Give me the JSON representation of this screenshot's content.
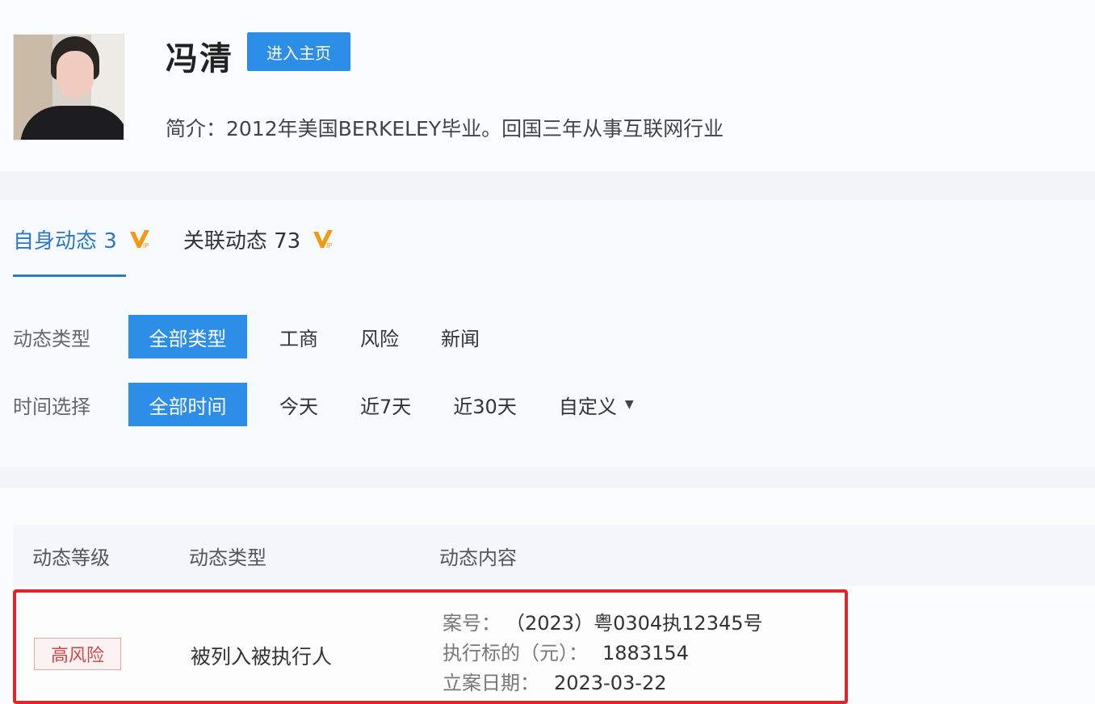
{
  "profile": {
    "name": "冯清",
    "home_button": "进入主页",
    "intro": "简介：2012年美国BERKELEY毕业。回国三年从事互联网行业"
  },
  "tabs": [
    {
      "label": "自身动态 3",
      "active": true
    },
    {
      "label": "关联动态 73",
      "active": false
    }
  ],
  "filters": {
    "type": {
      "label": "动态类型",
      "options": [
        "全部类型",
        "工商",
        "风险",
        "新闻"
      ],
      "selected": "全部类型"
    },
    "time": {
      "label": "时间选择",
      "options": [
        "全部时间",
        "今天",
        "近7天",
        "近30天",
        "自定义"
      ],
      "selected": "全部时间"
    }
  },
  "table": {
    "headers": [
      "动态等级",
      "动态类型",
      "动态内容"
    ],
    "rows": [
      {
        "level": "高风险",
        "type": "被列入被执行人",
        "details": [
          {
            "key": "案号：",
            "value": "（2023）粤0304执12345号"
          },
          {
            "key": "执行标的（元）：",
            "value": "1883154"
          },
          {
            "key": "立案日期：",
            "value": "2023-03-22"
          }
        ]
      }
    ]
  },
  "colors": {
    "accent": "#2d8ee8",
    "active_tab": "#2a78c6",
    "highlight_border": "#e0262b",
    "risk": "#d04848",
    "vip_badge": "#f29a16"
  },
  "icons": {
    "vip": "vip-badge-icon",
    "dropdown": "caret-down-icon"
  }
}
